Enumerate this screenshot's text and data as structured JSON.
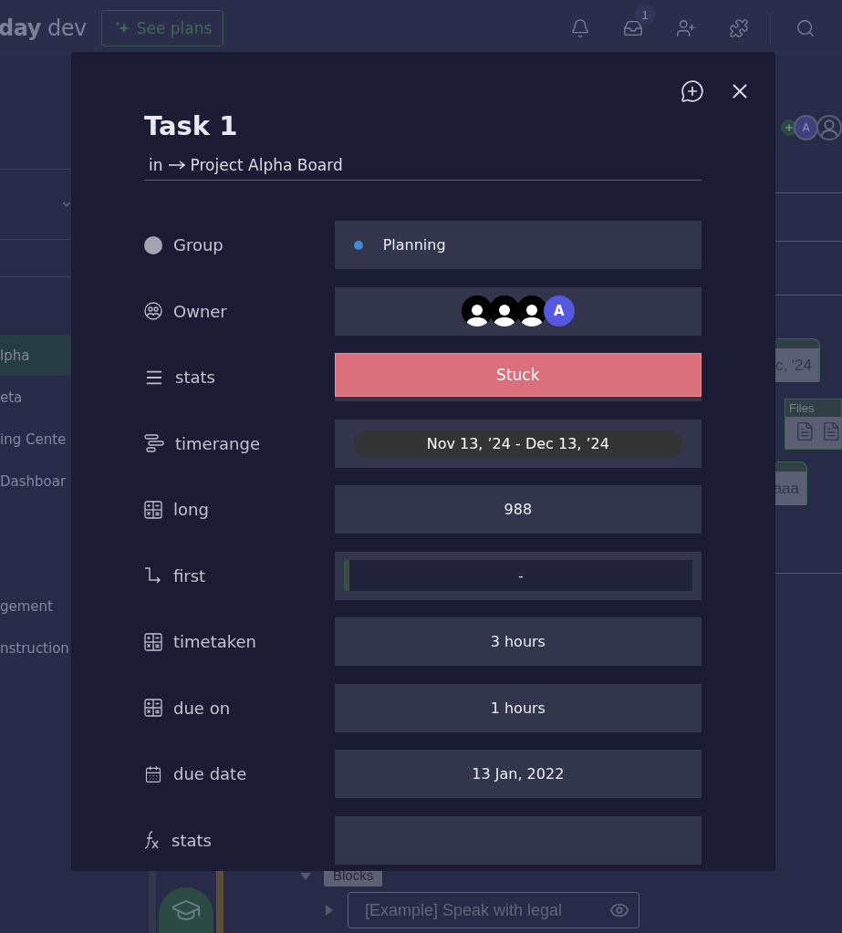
{
  "topbar": {
    "logo": "**day** dev",
    "upgrade_button": "See plans",
    "inbox_badge": "1"
  },
  "sidebar": {
    "items": [
      {
        "label": "lpha",
        "selected": true
      },
      {
        "label": "eta",
        "selected": false
      },
      {
        "label": "ing Cente",
        "selected": false
      },
      {
        "label": "Dashboar",
        "selected": false
      },
      {
        "label": "gement",
        "selected": false
      },
      {
        "label": "nstruction",
        "selected": false
      }
    ]
  },
  "board_right": {
    "avatar_initial": "A",
    "date_cell": "c, '24",
    "files_label": "Files",
    "text_cell": "aaa"
  },
  "board_bottom": {
    "group_tag": "Blocks",
    "item_name": "[Example] Speak with legal"
  },
  "item_dialog": {
    "title": "Task 1",
    "breadcrumb_prefix": "in",
    "breadcrumb_board": "Project Alpha Board",
    "fields": [
      {
        "kind": "group",
        "label": "Group",
        "value": "Planning",
        "color": "#3d8bd0"
      },
      {
        "kind": "people",
        "label": "Owner",
        "people": [
          {
            "kind": "silhouette"
          },
          {
            "kind": "silhouette"
          },
          {
            "kind": "silhouette"
          },
          {
            "kind": "initial",
            "initial": "A"
          }
        ]
      },
      {
        "kind": "status",
        "label": "stats",
        "value": "Stuck",
        "color": "#d9707b"
      },
      {
        "kind": "timeline",
        "label": "timerange",
        "value": "Nov 13, ’24 - Dec 13, ’24"
      },
      {
        "kind": "numbers",
        "label": "long",
        "value": "988"
      },
      {
        "kind": "dependency",
        "label": "first",
        "value": "-"
      },
      {
        "kind": "numbers",
        "label": "timetaken",
        "value": "3 hours"
      },
      {
        "kind": "numbers",
        "label": "due on",
        "value": "1 hours"
      },
      {
        "kind": "date",
        "label": "due date",
        "value": "13 Jan, 2022"
      },
      {
        "kind": "formula",
        "label": "stats"
      }
    ]
  }
}
